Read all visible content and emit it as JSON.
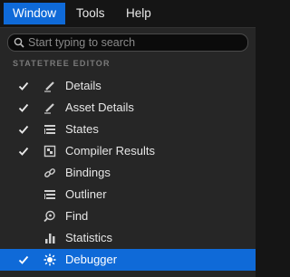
{
  "menubar": {
    "items": [
      {
        "label": "Window"
      },
      {
        "label": "Tools"
      },
      {
        "label": "Help"
      }
    ]
  },
  "search": {
    "placeholder": "Start typing to search",
    "icon": "search-icon"
  },
  "section": {
    "title": "STATETREE EDITOR"
  },
  "items": [
    {
      "label": "Details",
      "checked": true,
      "icon": "pencil-icon"
    },
    {
      "label": "Asset Details",
      "checked": true,
      "icon": "pencil-icon"
    },
    {
      "label": "States",
      "checked": true,
      "icon": "list-icon"
    },
    {
      "label": "Compiler Results",
      "checked": true,
      "icon": "compiler-icon"
    },
    {
      "label": "Bindings",
      "checked": false,
      "icon": "link-icon"
    },
    {
      "label": "Outliner",
      "checked": false,
      "icon": "list-icon"
    },
    {
      "label": "Find",
      "checked": false,
      "icon": "find-icon"
    },
    {
      "label": "Statistics",
      "checked": false,
      "icon": "bar-chart-icon"
    },
    {
      "label": "Debugger",
      "checked": true,
      "selected": true,
      "icon": "debugger-icon"
    }
  ],
  "colors": {
    "accent": "#0f6ad8",
    "background": "#262626",
    "menubar": "#151515"
  }
}
